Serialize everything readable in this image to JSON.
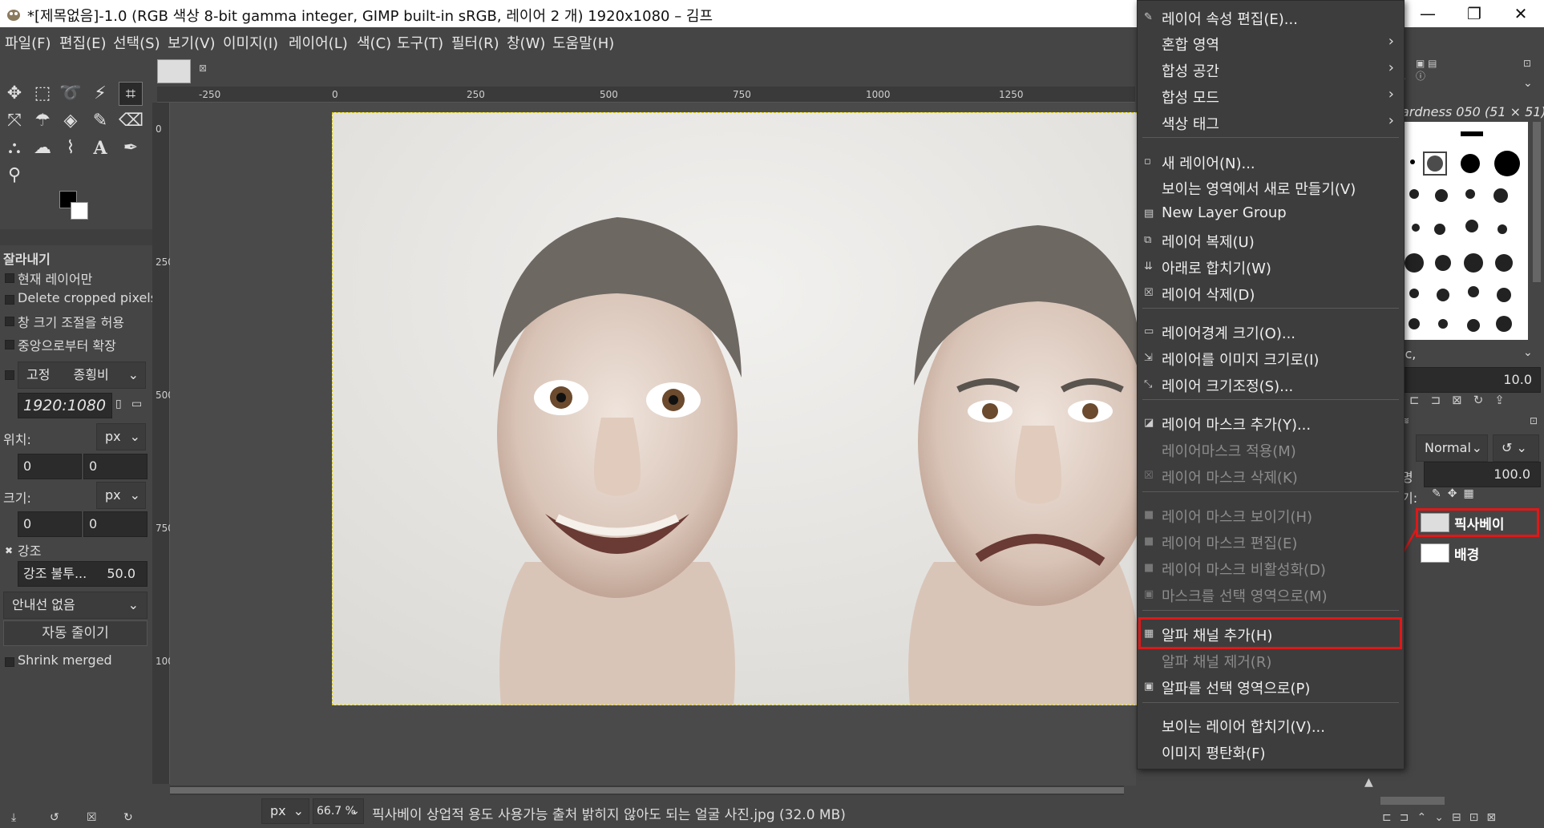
{
  "window": {
    "title": "*[제목없음]-1.0 (RGB 색상 8-bit gamma integer, GIMP built-in sRGB, 레이어 2 개) 1920x1080 – 김프",
    "minimize": "—",
    "maximize": "❐",
    "close": "✕"
  },
  "menubar": [
    "파일(F)",
    "편집(E)",
    "선택(S)",
    "보기(V)",
    "이미지(I)",
    "레이어(L)",
    "색(C)",
    "도구(T)",
    "필터(R)",
    "창(W)",
    "도움말(H)"
  ],
  "tool_options": {
    "title": "잘라내기",
    "current_layer_only": "현재 레이어만",
    "delete_cropped": "Delete cropped pixels",
    "allow_growing": "창 크기 조절을 허용",
    "expand_from_center": "중앙으로부터 확장",
    "fixed": "고정",
    "aspect": "종횡비",
    "ratio_value": "1920:1080",
    "position_label": "위치:",
    "position_unit": "px",
    "pos_x": "0",
    "pos_y": "0",
    "size_label": "크기:",
    "size_unit": "px",
    "size_w": "0",
    "size_h": "0",
    "highlight": "강조",
    "highlight_opacity_label": "강조 불투...",
    "highlight_opacity_value": "50.0",
    "guides": "안내선 없음",
    "auto_shrink": "자동 줄이기",
    "shrink_merged": "Shrink merged"
  },
  "ruler": {
    "h_ticks": [
      "-250",
      "0",
      "250",
      "500",
      "750",
      "1000",
      "1250"
    ],
    "v_ticks": [
      "0",
      "250",
      "500",
      "750",
      "1000"
    ]
  },
  "statusbar": {
    "unit": "px",
    "zoom": "66.7 %",
    "message": "픽사베이 상업적 용도 사용가능 출처 밝히지 않아도 되는 얼굴 사진.jpg (32.0 MB)"
  },
  "context_menu": {
    "items": [
      {
        "label": "레이어 속성 편집(E)...",
        "icon": "edit-icon",
        "disabled": false,
        "submenu": false
      },
      {
        "label": "혼합 영역",
        "icon": "",
        "disabled": false,
        "submenu": true
      },
      {
        "label": "합성 공간",
        "icon": "",
        "disabled": false,
        "submenu": true
      },
      {
        "label": "합성 모드",
        "icon": "",
        "disabled": false,
        "submenu": true
      },
      {
        "label": "색상 태그",
        "icon": "",
        "disabled": false,
        "submenu": true
      },
      {
        "label": "새 레이어(N)...",
        "icon": "new-layer-icon",
        "disabled": false,
        "submenu": false
      },
      {
        "label": "보이는 영역에서 새로 만들기(V)",
        "icon": "",
        "disabled": false,
        "submenu": false
      },
      {
        "label": "New Layer Group",
        "icon": "layer-group-icon",
        "disabled": false,
        "submenu": false
      },
      {
        "label": "레이어 복제(U)",
        "icon": "duplicate-icon",
        "disabled": false,
        "submenu": false
      },
      {
        "label": "아래로 합치기(W)",
        "icon": "merge-down-icon",
        "disabled": false,
        "submenu": false
      },
      {
        "label": "레이어 삭제(D)",
        "icon": "delete-icon",
        "disabled": false,
        "submenu": false
      },
      {
        "label": "레이어경계 크기(O)...",
        "icon": "boundary-icon",
        "disabled": false,
        "submenu": false
      },
      {
        "label": "레이어를 이미지 크기로(I)",
        "icon": "to-image-size-icon",
        "disabled": false,
        "submenu": false
      },
      {
        "label": "레이어 크기조정(S)...",
        "icon": "scale-icon",
        "disabled": false,
        "submenu": false
      },
      {
        "label": "레이어 마스크 추가(Y)...",
        "icon": "add-mask-icon",
        "disabled": false,
        "submenu": false
      },
      {
        "label": "레이어마스크 적용(M)",
        "icon": "",
        "disabled": true,
        "submenu": false
      },
      {
        "label": "레이어 마스크 삭제(K)",
        "icon": "delete-mask-icon",
        "disabled": true,
        "submenu": false
      },
      {
        "label": "레이어 마스크 보이기(H)",
        "icon": "checkbox-icon",
        "disabled": true,
        "submenu": false
      },
      {
        "label": "레이어 마스크 편집(E)",
        "icon": "checkbox-icon",
        "disabled": true,
        "submenu": false
      },
      {
        "label": "레이어 마스크 비활성화(D)",
        "icon": "checkbox-icon",
        "disabled": true,
        "submenu": false
      },
      {
        "label": "마스크를 선택 영역으로(M)",
        "icon": "mask-to-selection-icon",
        "disabled": true,
        "submenu": false
      },
      {
        "label": "알파 채널 추가(H)",
        "icon": "alpha-icon",
        "disabled": false,
        "submenu": false,
        "highlighted": true
      },
      {
        "label": "알파 채널 제거(R)",
        "icon": "",
        "disabled": true,
        "submenu": false
      },
      {
        "label": "알파를 선택 영역으로(P)",
        "icon": "alpha-to-selection-icon",
        "disabled": false,
        "submenu": false
      },
      {
        "label": "보이는 레이어 합치기(V)...",
        "icon": "",
        "disabled": false,
        "submenu": false
      },
      {
        "label": "이미지 평탄화(F)",
        "icon": "",
        "disabled": false,
        "submenu": false
      }
    ]
  },
  "dock": {
    "brush_name": "ardness 050 (51 × 51)",
    "brush_filter": "ic,",
    "spacing_value": "10.0",
    "mode": "Normal",
    "opacity_label": "명",
    "opacity_value": "100.0",
    "lock_label": "기:",
    "layers": [
      "픽사베이",
      "배경"
    ]
  },
  "highlight_color": "#e01818"
}
